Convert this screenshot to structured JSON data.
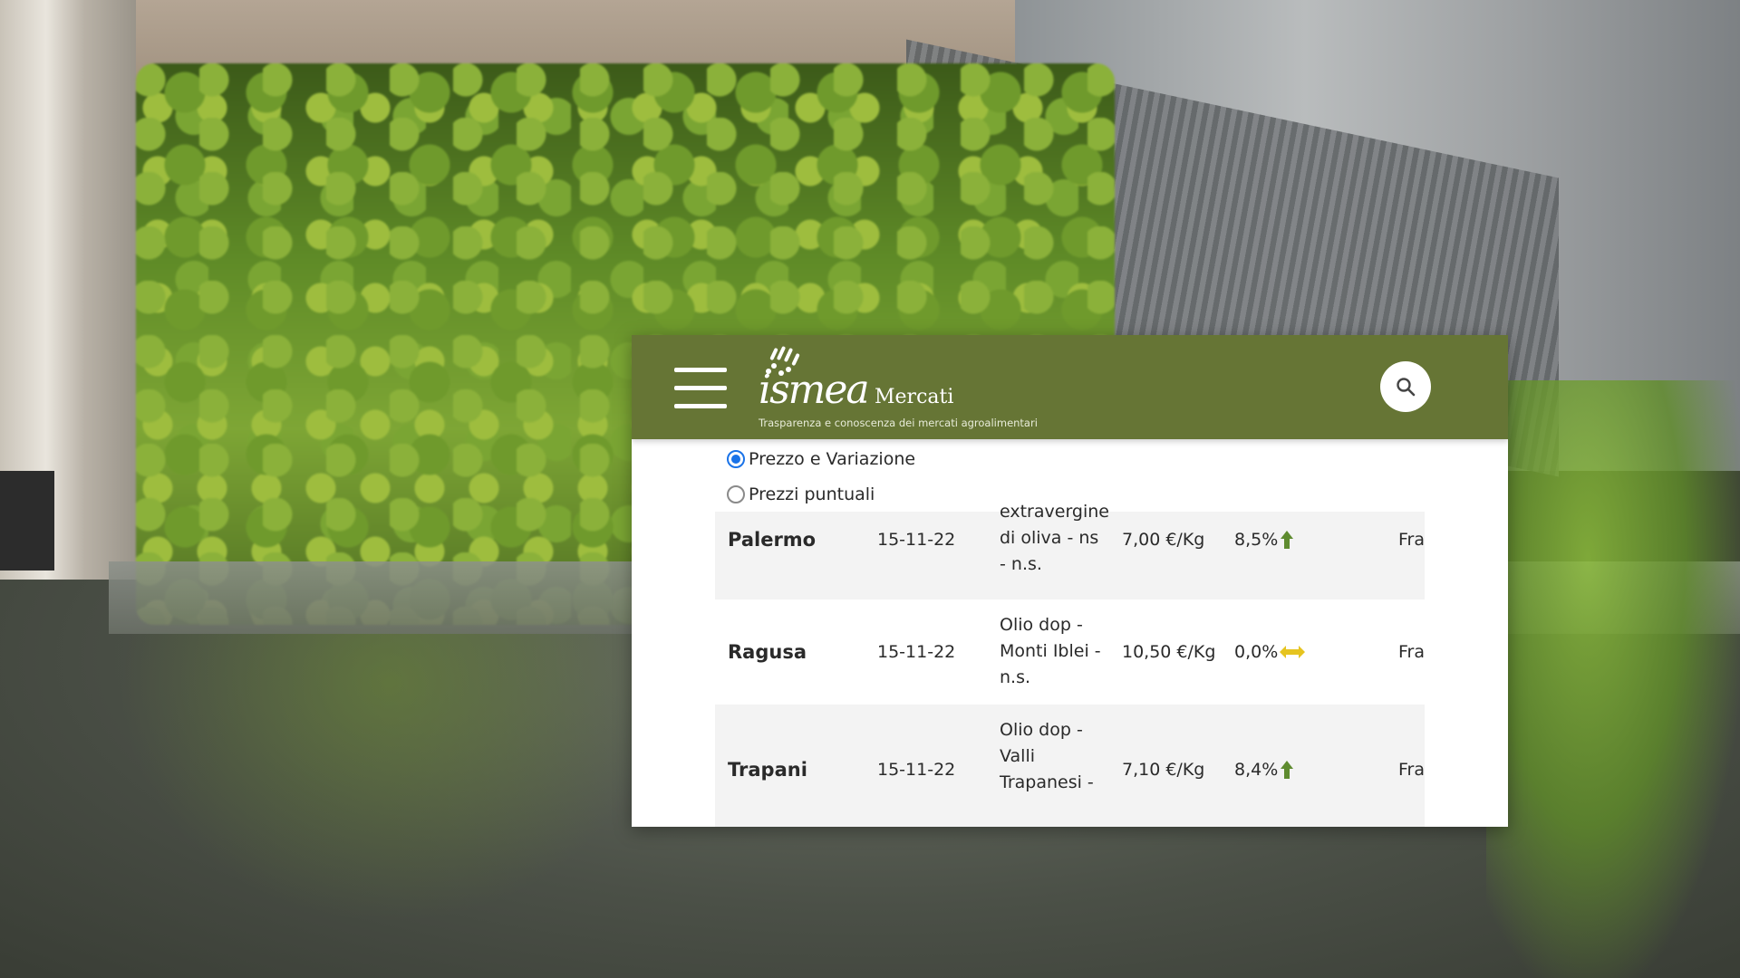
{
  "header": {
    "brand_word": "ismea",
    "brand_sub": "Mercati",
    "tagline": "Trasparenza e conoscenza dei mercati agroalimentari",
    "brand_color": "#667535"
  },
  "filters": {
    "options": [
      {
        "label": "Prezzo e Variazione",
        "checked": true
      },
      {
        "label": "Prezzi puntuali",
        "checked": false
      }
    ]
  },
  "table": {
    "rows": [
      {
        "city": "Palermo",
        "date": "15-11-22",
        "product_lines": [
          "extravergine",
          "di oliva - ns",
          "- n.s."
        ],
        "price": "7,00 €/Kg",
        "variation": "8,5%",
        "trend": "up",
        "region": "Fra"
      },
      {
        "city": "Ragusa",
        "date": "15-11-22",
        "product_lines": [
          "Olio dop -",
          "Monti Iblei -",
          "n.s."
        ],
        "price": "10,50 €/Kg",
        "variation": "0,0%",
        "trend": "stable",
        "region": "Fra"
      },
      {
        "city": "Trapani",
        "date": "15-11-22",
        "product_lines": [
          "Olio dop -",
          "Valli",
          "Trapanesi -"
        ],
        "price": "7,10 €/Kg",
        "variation": "8,4%",
        "trend": "up",
        "region": "Fra"
      }
    ]
  },
  "colors": {
    "trend_up": "#5e8b2f",
    "trend_stable": "#e6c420",
    "radio_selected": "#1a73e8"
  }
}
